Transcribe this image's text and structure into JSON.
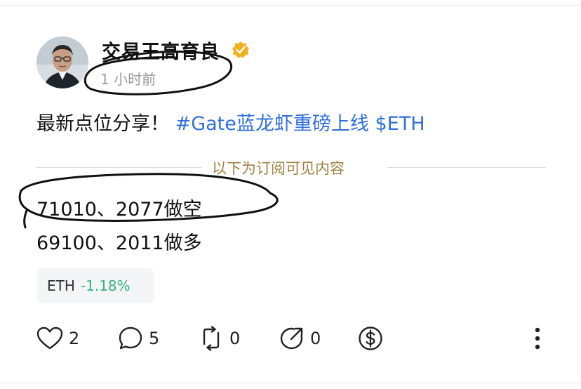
{
  "post": {
    "author": "交易王高育良",
    "time": "1 小时前",
    "content_text": "最新点位分享！",
    "content_tags": "#Gate蓝龙虾重磅上线 $ETH",
    "divider_text": "以下为订阅可见内容",
    "points": [
      "71010、2077做空",
      "69100、2011做多"
    ]
  },
  "ticker": {
    "symbol": "ETH",
    "change": "-1.18%"
  },
  "actions": {
    "like_count": "2",
    "comment_count": "5",
    "repost_count": "0",
    "share_count": "0"
  },
  "icons": [
    "heart-icon",
    "comment-icon",
    "repost-icon",
    "share-icon",
    "tip-dollar-icon",
    "more-vertical-icon",
    "verified-badge-icon"
  ],
  "colors": {
    "tag_blue": "#2f6fde",
    "divider_gold": "#a0813f",
    "positive_green": "#36b37e",
    "verified_gold": "#f2b01e",
    "muted_gray": "#9a9a9a"
  }
}
